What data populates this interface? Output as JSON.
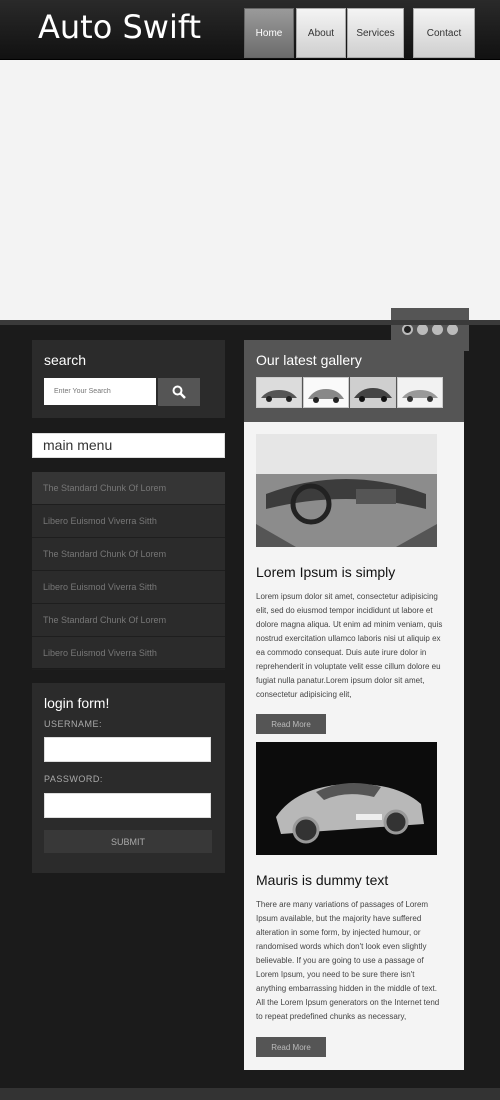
{
  "header": {
    "logo": "Auto Swift",
    "nav": [
      "Home",
      "About",
      "Services",
      "Contact"
    ]
  },
  "search": {
    "title": "search",
    "placeholder": "Enter Your Search"
  },
  "menu": {
    "title": "main menu",
    "items": [
      "The Standard Chunk Of Lorem",
      "Libero Euismod Viverra Sitth",
      "The Standard Chunk Of Lorem",
      "Libero Euismod Viverra Sitth",
      "The Standard Chunk Of Lorem",
      "Libero Euismod Viverra Sitth"
    ]
  },
  "login": {
    "title": "login form!",
    "username_label": "USERNAME:",
    "password_label": "PASSWORD:",
    "submit": "SUBMIT"
  },
  "gallery": {
    "title": "Our latest gallery"
  },
  "articles": [
    {
      "title": "Lorem Ipsum is simply",
      "body": "Lorem ipsum dolor sit amet, consectetur adipisicing elit, sed do eiusmod tempor incididunt ut labore et dolore magna aliqua. Ut enim ad minim veniam, quis nostrud exercitation ullamco laboris nisi ut aliquip ex ea commodo consequat. Duis aute irure dolor in reprehenderit in voluptate velit esse cillum dolore eu fugiat nulla panatur.Lorem ipsum dolor sit amet, consectetur adipisicing elit,",
      "button": "Read More"
    },
    {
      "title": "Mauris is dummy text",
      "body": "There are many variations of passages of Lorem Ipsum available, but the majority have suffered alteration in some form, by injected humour, or randomised words which don't look even slightly believable. If you are going to use a passage of Lorem Ipsum, you need to be sure there isn't anything embarrassing hidden in the middle of text. All the Lorem Ipsum generators on the Internet tend to repeat predefined chunks as necessary,",
      "button": "Read More"
    }
  ]
}
